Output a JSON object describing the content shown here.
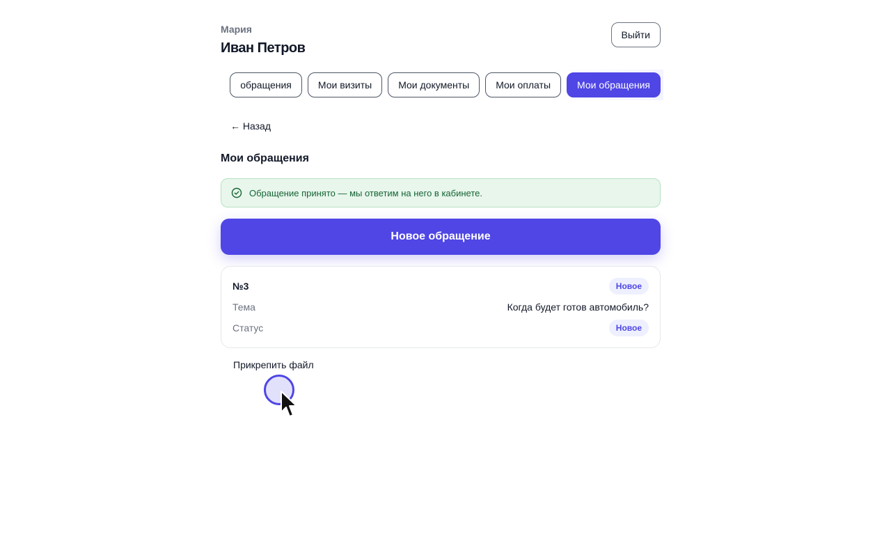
{
  "header": {
    "user_sub": "Мария",
    "user_name": "Иван Петров",
    "logout_label": "Выйти"
  },
  "tabs": [
    {
      "label": "обращения",
      "active": false
    },
    {
      "label": "Мои визиты",
      "active": false
    },
    {
      "label": "Мои документы",
      "active": false
    },
    {
      "label": "Мои оплаты",
      "active": false
    },
    {
      "label": "Мои обращения",
      "active": true
    }
  ],
  "back_label": "← Назад",
  "page_title": "Мои обращения",
  "alert": {
    "icon": "check-circle-icon",
    "text": "Обращение принято — мы ответим на него в кабинете."
  },
  "new_request_label": "Новое обращение",
  "request": {
    "number": "№3",
    "badge": "Новое",
    "topic_label": "Тема",
    "topic_value": "Когда будет готов автомобиль?",
    "status_label": "Статус",
    "status_value": "Новое"
  },
  "attach_label": "Прикрепить файл",
  "colors": {
    "accent": "#4f46e5",
    "success_bg": "#e8f6ec",
    "success_text": "#166534"
  }
}
